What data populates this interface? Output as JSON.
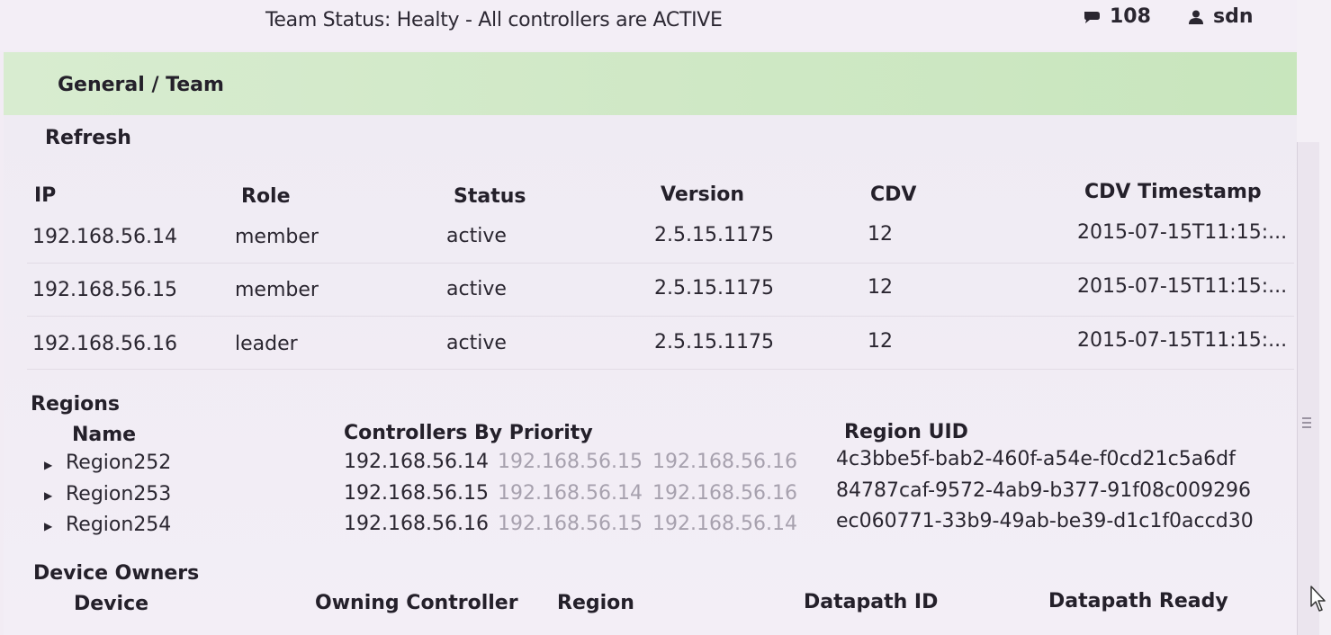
{
  "header": {
    "team_status": "Team Status: Healty - All controllers are ACTIVE",
    "alerts_count": "108",
    "username": "sdn"
  },
  "breadcrumb": "General / Team",
  "refresh_label": "Refresh",
  "team_table": {
    "headers": [
      "IP",
      "Role",
      "Status",
      "Version",
      "CDV",
      "CDV Timestamp"
    ],
    "rows": [
      [
        "192.168.56.14",
        "member",
        "active",
        "2.5.15.1175",
        "12",
        "2015-07-15T11:15:..."
      ],
      [
        "192.168.56.15",
        "member",
        "active",
        "2.5.15.1175",
        "12",
        "2015-07-15T11:15:..."
      ],
      [
        "192.168.56.16",
        "leader",
        "active",
        "2.5.15.1175",
        "12",
        "2015-07-15T11:15:..."
      ]
    ]
  },
  "regions": {
    "title": "Regions",
    "headers": [
      "Name",
      "Controllers By Priority",
      "Region UID"
    ],
    "rows": [
      {
        "name": "Region252",
        "primary": "192.168.56.14",
        "secondary": [
          "192.168.56.15",
          "192.168.56.16"
        ],
        "uid": "4c3bbe5f-bab2-460f-a54e-f0cd21c5a6df"
      },
      {
        "name": "Region253",
        "primary": "192.168.56.15",
        "secondary": [
          "192.168.56.14",
          "192.168.56.16"
        ],
        "uid": "84787caf-9572-4ab9-b377-91f08c009296"
      },
      {
        "name": "Region254",
        "primary": "192.168.56.16",
        "secondary": [
          "192.168.56.15",
          "192.168.56.14"
        ],
        "uid": "ec060771-33b9-49ab-be39-d1c1f0accd30"
      }
    ]
  },
  "device_owners": {
    "title": "Device Owners",
    "headers": [
      "Device",
      "Owning Controller",
      "Region",
      "Datapath ID",
      "Datapath Ready"
    ]
  },
  "icons": {
    "alerts": "alerts-flag-icon",
    "user": "user-icon",
    "expand": "expand-caret-icon",
    "cursor": "mouse-pointer-icon"
  },
  "colors": {
    "header_bar": "#cfe8c5",
    "muted_text": "#a7a1ae",
    "background": "#f2ecf4"
  }
}
